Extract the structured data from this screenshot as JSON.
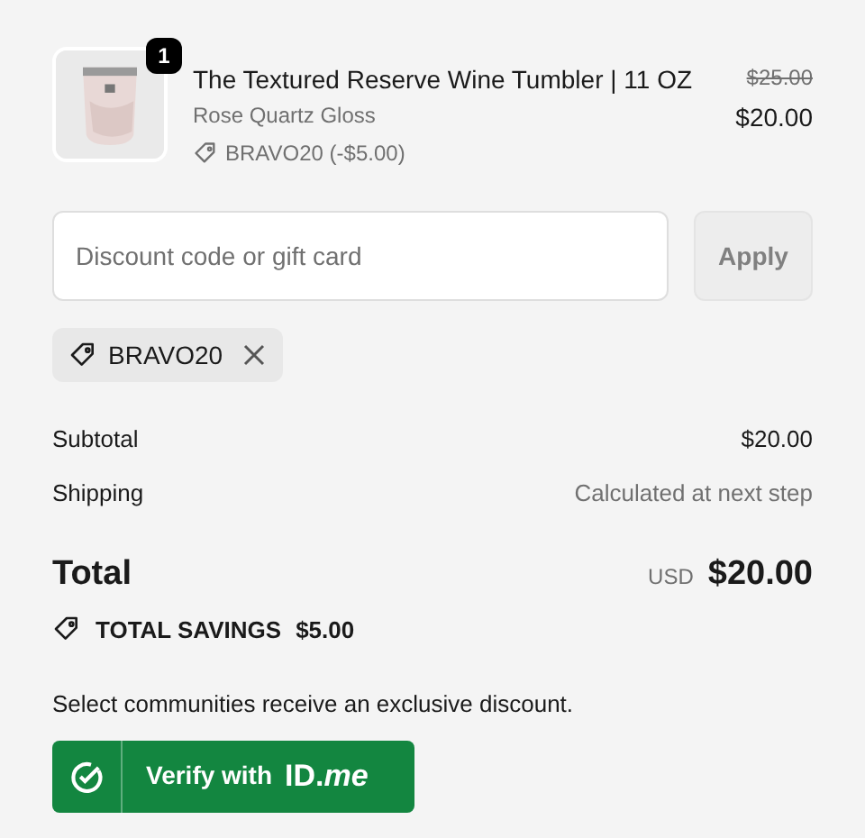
{
  "product": {
    "quantity": "1",
    "title": "The Textured Reserve Wine Tumbler | 11 OZ",
    "variant": "Rose Quartz Gloss",
    "discount": "BRAVO20 (-$5.00)",
    "original_price": "$25.00",
    "price": "$20.00"
  },
  "discount_field": {
    "placeholder": "Discount code or gift card",
    "button": "Apply",
    "disabled": true
  },
  "applied_codes": [
    {
      "code": "BRAVO20"
    }
  ],
  "summary": [
    {
      "label": "Subtotal",
      "value": "$20.00",
      "muted": false
    },
    {
      "label": "Shipping",
      "value": "Calculated at next step",
      "muted": true
    }
  ],
  "total": {
    "label": "Total",
    "currency": "USD",
    "amount": "$20.00"
  },
  "savings": {
    "label": "TOTAL SAVINGS",
    "amount": "$5.00"
  },
  "communities": {
    "text": "Select communities receive an exclusive discount.",
    "button": "Verify with",
    "brand": "**ID**.*me*"
  }
}
